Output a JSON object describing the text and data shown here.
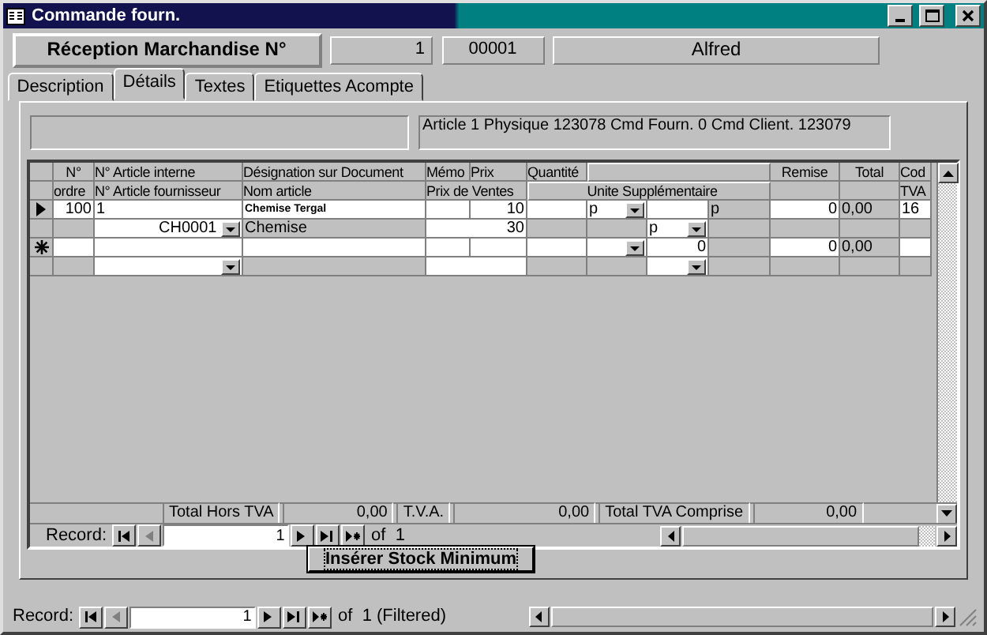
{
  "window": {
    "title": "Commande fourn."
  },
  "header": {
    "title": "Réception Marchandise N°",
    "number": "1",
    "code": "00001",
    "name": "Alfred"
  },
  "tabs": [
    {
      "label": "Description",
      "selected": false
    },
    {
      "label": "Détails",
      "selected": true
    },
    {
      "label": "Textes",
      "selected": false
    },
    {
      "label": "Etiquettes Acompte",
      "selected": false
    }
  ],
  "article_info": "Article 1 Physique 123078 Cmd Fourn. 0 Cmd Client. 123079",
  "columns": {
    "ordre_1": "N°",
    "ordre_2": "ordre",
    "article_1": "N° Article interne",
    "article_2": "N° Article fournisseur",
    "designation_1": "Désignation sur Document",
    "designation_2": "Nom article",
    "memo": "Mémo",
    "prix": "Prix",
    "prix_ventes": "Prix de Ventes",
    "quantite": "Quantité",
    "unite_suppl": "Unite Supplémentaire",
    "remise": "Remise",
    "total": "Total",
    "tva_1": "Cod",
    "tva_2": "TVA"
  },
  "rows": [
    {
      "kind": "current",
      "ordre": "100",
      "article_interne": "1",
      "designation": "Chemise Tergal",
      "prix": "10",
      "unite": "p",
      "unite_suppl": "p",
      "remise": "0",
      "total": "0,00",
      "code_tva": "16",
      "article_fournisseur": "CH0001",
      "nom_article": "Chemise",
      "prix_ventes": "30",
      "unite_2": "p"
    },
    {
      "kind": "new",
      "quantite_suppl": "0",
      "remise": "0",
      "total": "0,00"
    }
  ],
  "totals": [
    {
      "label": "Total Hors TVA",
      "value": "0,00"
    },
    {
      "label": "T.V.A.",
      "value": "0,00"
    },
    {
      "label": "Total TVA Comprise",
      "value": "0,00"
    }
  ],
  "sub_navigator": {
    "label": "Record:",
    "current": "1",
    "count": "of  1"
  },
  "button": "Insérer Stock Minimum",
  "form_navigator": {
    "label": "Record:",
    "current": "1",
    "count": "of  1 (Filtered)"
  }
}
